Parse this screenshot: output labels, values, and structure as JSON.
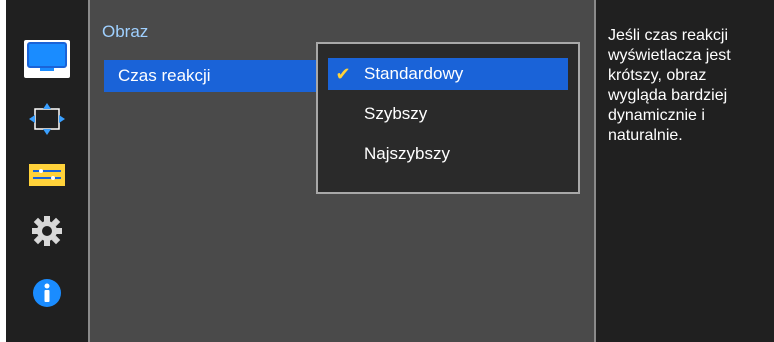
{
  "panel": {
    "title": "Obraz",
    "menu_item": "Czas reakcji"
  },
  "dropdown": {
    "options": [
      {
        "label": "Standardowy",
        "selected": true
      },
      {
        "label": "Szybszy",
        "selected": false
      },
      {
        "label": "Najszybszy",
        "selected": false
      }
    ]
  },
  "help": {
    "text": "Jeśli czas reakcji wyświetlacza jest krótszy, obraz wygląda bardziej dynamicznie i naturalnie."
  },
  "rail": {
    "icons": [
      "monitor-icon",
      "move-arrows-icon",
      "menu-settings-icon",
      "gear-icon",
      "info-icon"
    ]
  },
  "colors": {
    "accent": "#1a63d8",
    "check": "#ffd23a",
    "title": "#9fd0ff"
  }
}
